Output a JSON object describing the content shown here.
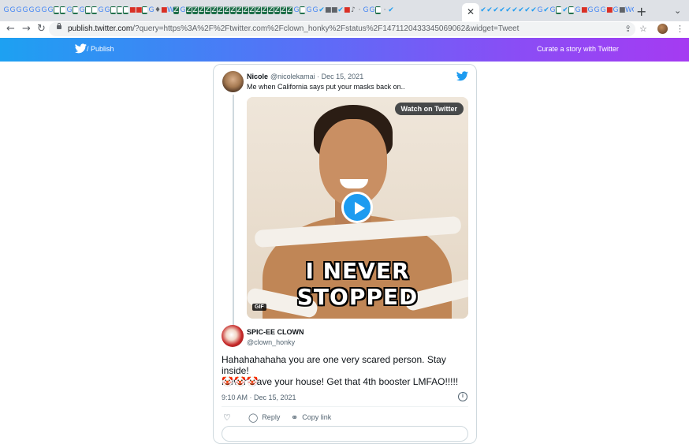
{
  "browser": {
    "url_host": "publish.twitter.com",
    "url_rest": "/?query=https%3A%2F%2Ftwitter.com%2Fclown_honky%2Fstatus%2F1471120433345069062&widget=Tweet",
    "tab_close": "✕",
    "new_tab": "+",
    "tab_menu": "⌄"
  },
  "publish": {
    "brand": "/ Publish",
    "curate": "Curate a story with Twitter"
  },
  "quoted_tweet": {
    "name": "Nicole",
    "handle": "@nicolekamai · Dec 15, 2021",
    "text": "Me when California says put your masks back on..",
    "watch_label": "Watch on Twitter",
    "caption_line1": "I NEVER",
    "caption_line2": "STOPPED",
    "gif_badge": "GIF"
  },
  "main_tweet": {
    "name": "SPIC-EE CLOWN",
    "handle": "@clown_honky",
    "text_line1": "Hahahahahaha you are one very scared person. Stay inside!",
    "text_line2": "Never leave your house! Get that 4th booster LMFAO!!!!!",
    "emojis": "🤡🤡🤡",
    "timestamp": "9:10 AM · Dec 15, 2021",
    "actions": {
      "reply": "Reply",
      "copy_link": "Copy link"
    }
  },
  "colors": {
    "twitter_blue": "#1d9bf0",
    "header_gradient_start": "#1da1f2",
    "header_gradient_end": "#a53bf2"
  }
}
